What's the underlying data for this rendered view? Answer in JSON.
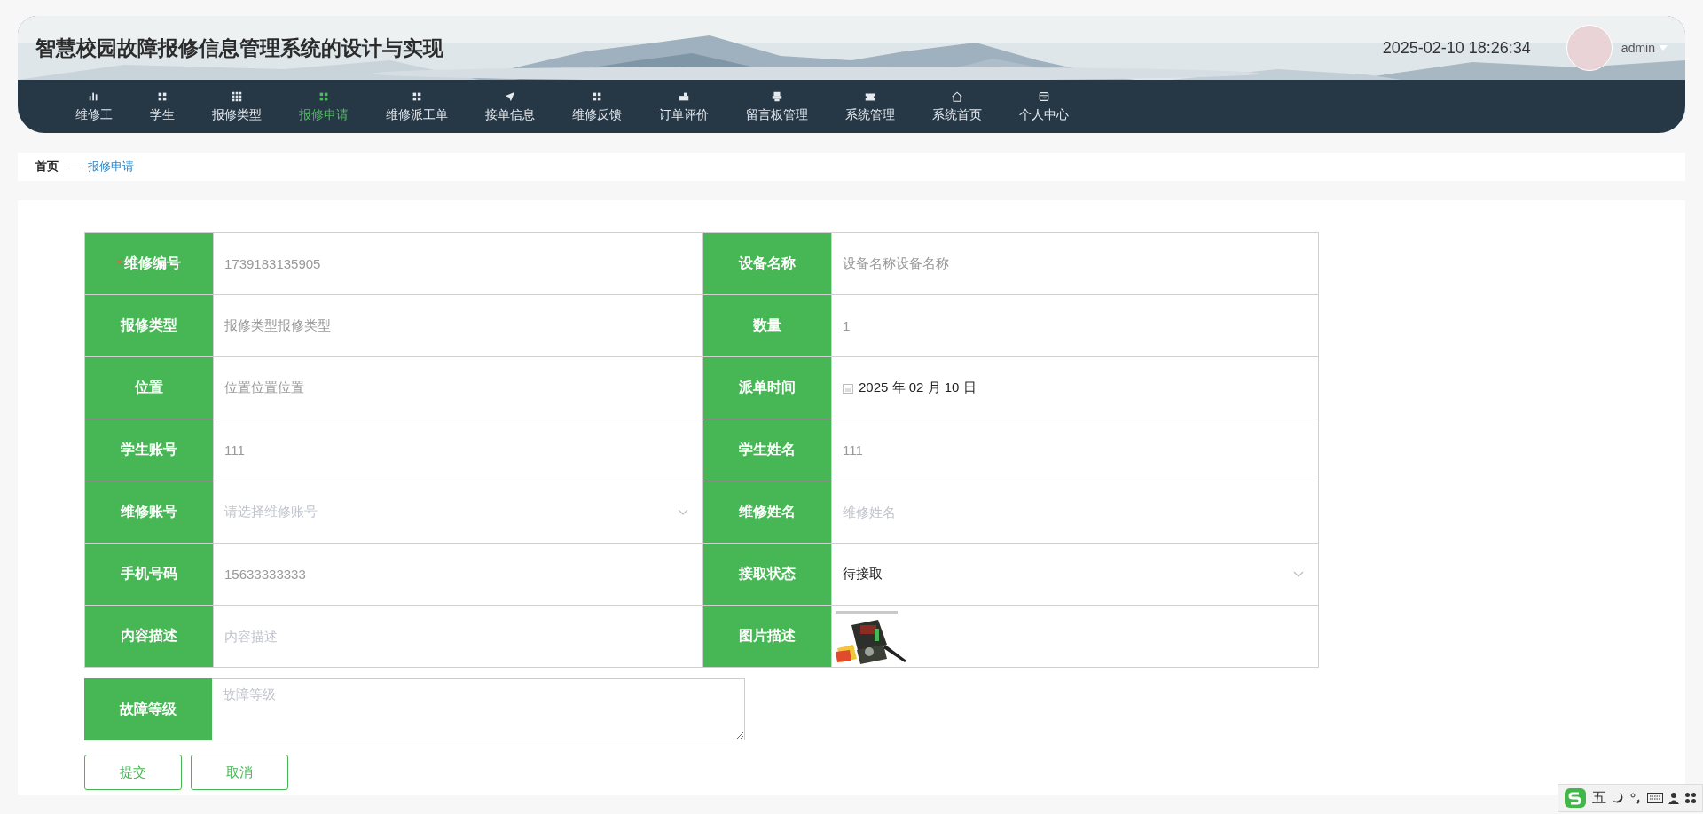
{
  "header": {
    "title": "智慧校园故障报修信息管理系统的设计与实现",
    "datetime": "2025-02-10 18:26:34",
    "user": "admin"
  },
  "nav": [
    {
      "label": "维修工",
      "selected": false
    },
    {
      "label": "学生",
      "selected": false
    },
    {
      "label": "报修类型",
      "selected": false
    },
    {
      "label": "报修申请",
      "selected": true
    },
    {
      "label": "维修派工单",
      "selected": false
    },
    {
      "label": "接单信息",
      "selected": false
    },
    {
      "label": "维修反馈",
      "selected": false
    },
    {
      "label": "订单评价",
      "selected": false
    },
    {
      "label": "留言板管理",
      "selected": false
    },
    {
      "label": "系统管理",
      "selected": false
    },
    {
      "label": "系统首页",
      "selected": false
    },
    {
      "label": "个人中心",
      "selected": false
    }
  ],
  "breadcrumb": {
    "home": "首页",
    "separator": "—",
    "current": "报修申请"
  },
  "form": {
    "fields": [
      {
        "label": "维修编号",
        "marker": "*",
        "kind": "text",
        "value": "1739183135905",
        "readonly": true
      },
      {
        "label": "设备名称",
        "kind": "text",
        "value": "设备名称设备名称",
        "readonly": true
      },
      {
        "label": "报修类型",
        "kind": "text",
        "value": "报修类型报修类型",
        "readonly": true
      },
      {
        "label": "数量",
        "kind": "text",
        "value": "1",
        "readonly": true
      },
      {
        "label": "位置",
        "kind": "text",
        "value": "位置位置位置",
        "readonly": true
      },
      {
        "label": "派单时间",
        "kind": "date",
        "value": "2025 年 02 月 10 日"
      },
      {
        "label": "学生账号",
        "kind": "text",
        "value": "111",
        "readonly": true
      },
      {
        "label": "学生姓名",
        "kind": "text",
        "value": "111",
        "readonly": true
      },
      {
        "label": "维修账号",
        "kind": "select",
        "placeholder": "请选择维修账号"
      },
      {
        "label": "维修姓名",
        "kind": "text",
        "placeholder": "维修姓名"
      },
      {
        "label": "手机号码",
        "kind": "text",
        "value": "15633333333",
        "readonly": true
      },
      {
        "label": "接取状态",
        "kind": "select",
        "value": "待接取"
      },
      {
        "label": "内容描述",
        "kind": "text",
        "placeholder": "内容描述"
      },
      {
        "label": "图片描述",
        "kind": "picture"
      }
    ],
    "textarea": {
      "label": "故障等级",
      "placeholder": "故障等级"
    },
    "buttons": [
      {
        "label": "提交"
      },
      {
        "label": "取消"
      }
    ]
  },
  "ime_bar": {
    "mode": "五"
  }
}
